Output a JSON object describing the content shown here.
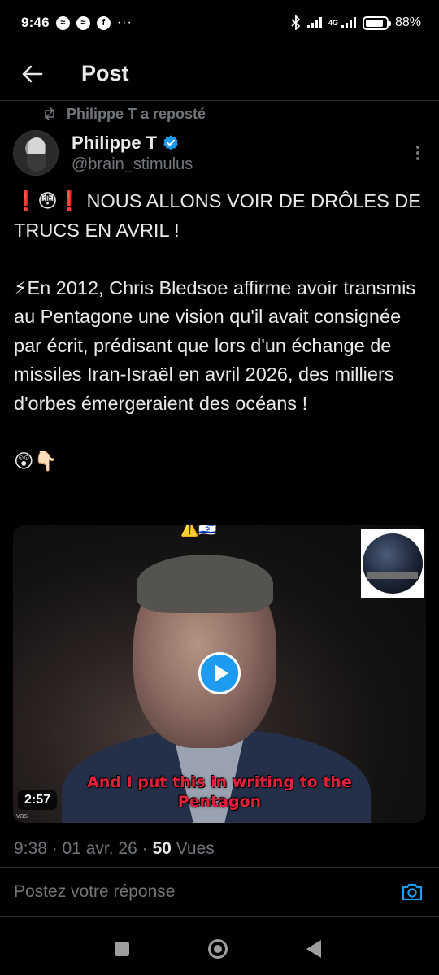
{
  "status_bar": {
    "time": "9:46",
    "notif_icons": [
      "messenger-icon",
      "messenger-icon",
      "facebook-icon"
    ],
    "more": "···",
    "network": "4G",
    "battery": "88%",
    "battery_level": 0.88
  },
  "header": {
    "back_icon": "arrow-left-icon",
    "title": "Post"
  },
  "repost": {
    "icon": "repost-icon",
    "text": "Philippe T a reposté"
  },
  "author": {
    "name": "Philippe T",
    "handle": "@brain_stimulus",
    "verified_color": "#1d9bf0"
  },
  "post": {
    "text": "❗😳❗ NOUS ALLONS VOIR DE DRÔLES DE TRUCS EN AVRIL !\n\n⚡En 2012, Chris Bledsoe affirme avoir transmis au Pentagone une vision qu'il avait consignée par écrit, prédisant que lors d'un échange de missiles Iran-Israël en avril 2026, des milliers d'orbes émergeraient des océans !\n\n😲👇🏻"
  },
  "video": {
    "top_emoji": "⚠️🇮🇱",
    "subtitle": "And I put this in writing to the Pentagon",
    "duration": "2:57",
    "watermark": "vas",
    "play_color": "#1d9bf0"
  },
  "meta": {
    "time": "9:38",
    "separator": " · ",
    "date": "01 avr. 26",
    "views_count": "50",
    "views_label": "Vues"
  },
  "reply": {
    "placeholder": "Postez votre réponse",
    "camera_icon": "camera-icon"
  },
  "colors": {
    "background": "#000000",
    "text": "#e7e9ea",
    "muted": "#71767b",
    "accent": "#1d9bf0",
    "divider": "#2f3336"
  }
}
